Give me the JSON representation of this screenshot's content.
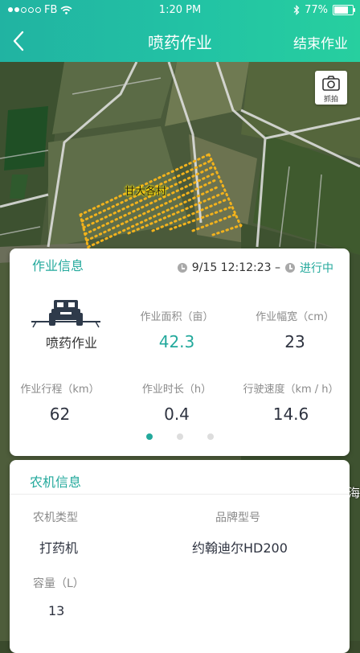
{
  "status_bar": {
    "carrier": "FB",
    "time": "1:20 PM",
    "battery": "77%",
    "battery_level": 0.77
  },
  "nav": {
    "title": "喷药作业",
    "action": "结束作业"
  },
  "map": {
    "camera_label": "抓拍",
    "village_label": "甘大各村",
    "edge_label": "海"
  },
  "work_info": {
    "title": "作业信息",
    "start_time": "9/15 12:12:23 –",
    "status": "进行中",
    "operation_type": "喷药作业",
    "stats": [
      {
        "label": "作业面积（亩）",
        "value": "42.3"
      },
      {
        "label": "作业幅宽（cm）",
        "value": "23"
      },
      {
        "label": "作业行程（km）",
        "value": "62"
      },
      {
        "label": "作业时长（h）",
        "value": "0.4"
      },
      {
        "label": "行驶速度（km / h）",
        "value": "14.6"
      }
    ],
    "page_count": 3,
    "active_page": 1
  },
  "machine_info": {
    "title": "农机信息",
    "fields": [
      {
        "label": "农机类型",
        "value": "打药机"
      },
      {
        "label": "品牌型号",
        "value": "约翰迪尔HD200"
      },
      {
        "label": "容量（L）",
        "value": "13"
      }
    ]
  },
  "colors": {
    "accent": "#23a99c",
    "header_start": "#21b3a2",
    "header_end": "#27cf9f",
    "route_dots": "#f2b21c"
  }
}
